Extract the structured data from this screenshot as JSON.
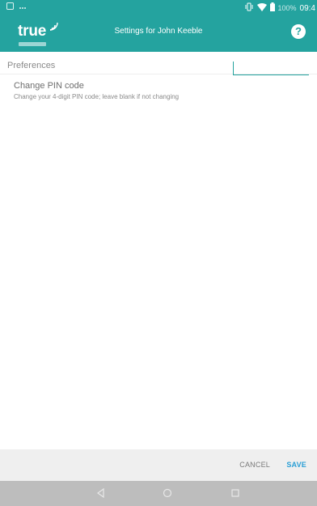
{
  "status_bar": {
    "battery_percent": "100%",
    "time": "09:4",
    "icons": [
      "notification-icon",
      "dots-icon",
      "vibrate-icon",
      "wifi-icon",
      "battery-icon"
    ]
  },
  "app_bar": {
    "logo_text": "true",
    "title": "Settings for John Keeble",
    "help_label": "?"
  },
  "preferences": {
    "section_header": "Preferences",
    "pin": {
      "title": "Change PIN code",
      "summary": "Change your 4-digit PIN code; leave blank if not changing",
      "value": ""
    }
  },
  "actions": {
    "cancel_label": "CANCEL",
    "save_label": "SAVE"
  },
  "nav_bar": {
    "icons": [
      "back-icon",
      "home-icon",
      "recents-icon"
    ]
  },
  "colors": {
    "primary": "#24a39f",
    "accent": "#2a9fd6",
    "background": "#f2f2f2",
    "nav_bar": "#bdbdbd"
  }
}
